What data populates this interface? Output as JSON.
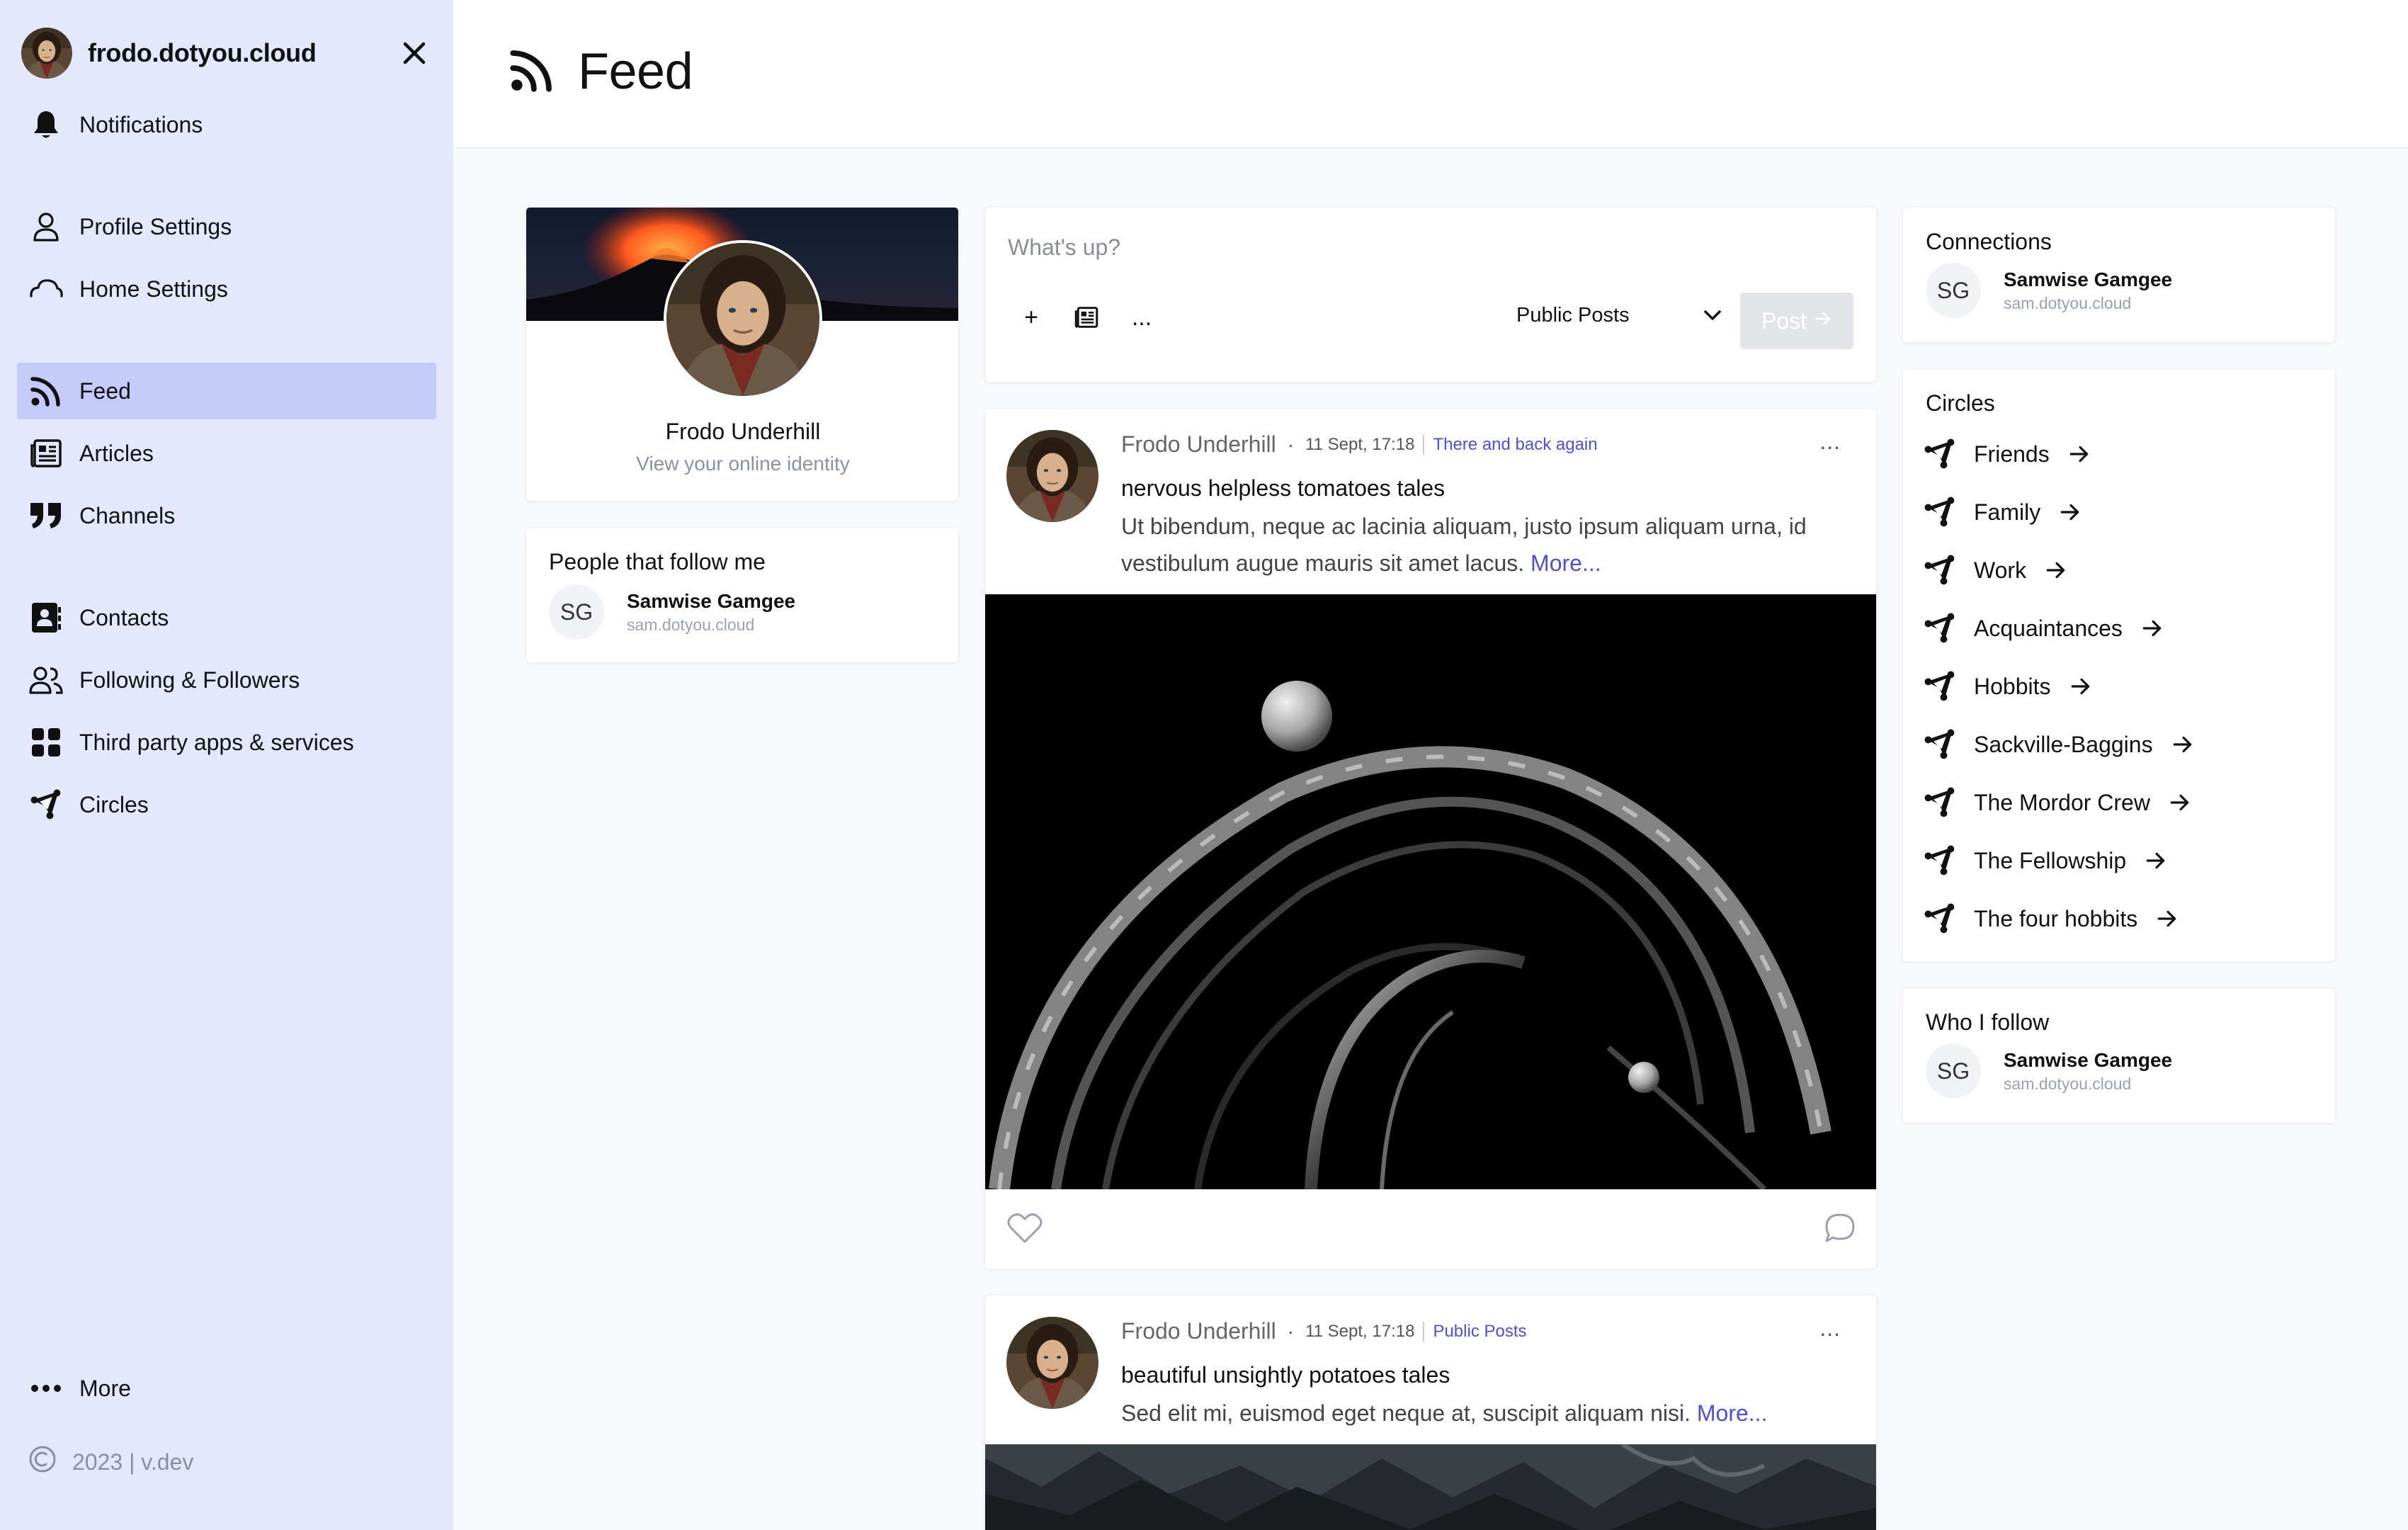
{
  "sidebar": {
    "domain": "frodo.dotyou.cloud",
    "notifications": "Notifications",
    "profile_settings": "Profile Settings",
    "home_settings": "Home Settings",
    "feed": "Feed",
    "articles": "Articles",
    "channels": "Channels",
    "contacts": "Contacts",
    "following": "Following & Followers",
    "third_party": "Third party apps & services",
    "circles": "Circles",
    "more": "More",
    "footer": "2023 | v.dev"
  },
  "header": {
    "title": "Feed"
  },
  "profile": {
    "name": "Frodo Underhill",
    "link": "View your online identity"
  },
  "followers": {
    "title": "People that follow me",
    "person": {
      "initials": "SG",
      "name": "Samwise Gamgee",
      "domain": "sam.dotyou.cloud"
    }
  },
  "composer": {
    "placeholder": "What's up?",
    "add": "+",
    "more": "...",
    "audience": "Public Posts",
    "post_label": "Post"
  },
  "posts": [
    {
      "author": "Frodo Underhill",
      "dot": "·",
      "date": "11 Sept, 17:18",
      "channel": "There and back again",
      "menu": "...",
      "title": "nervous helpless tomatoes tales",
      "body": "Ut bibendum, neque ac lacinia aliquam, justo ipsum aliquam urna, id vestibulum augue mauris sit amet lacus.",
      "more": "More..."
    },
    {
      "author": "Frodo Underhill",
      "dot": "·",
      "date": "11 Sept, 17:18",
      "channel": "Public Posts",
      "menu": "...",
      "title": "beautiful unsightly potatoes tales",
      "body": "Sed elit mi, euismod eget neque at, suscipit aliquam nisi.",
      "more": "More..."
    }
  ],
  "connections": {
    "title": "Connections",
    "person": {
      "initials": "SG",
      "name": "Samwise Gamgee",
      "domain": "sam.dotyou.cloud"
    }
  },
  "circles": {
    "title": "Circles",
    "items": [
      "Friends",
      "Family",
      "Work",
      "Acquaintances",
      "Hobbits",
      "Sackville-Baggins",
      "The Mordor Crew",
      "The Fellowship",
      "The four hobbits"
    ]
  },
  "who_i_follow": {
    "title": "Who I follow",
    "person": {
      "initials": "SG",
      "name": "Samwise Gamgee",
      "domain": "sam.dotyou.cloud"
    }
  },
  "colors": {
    "sidebar_bg": "#e4e7fd",
    "active_nav": "#c5cbf9",
    "link": "#4d4fd8"
  }
}
